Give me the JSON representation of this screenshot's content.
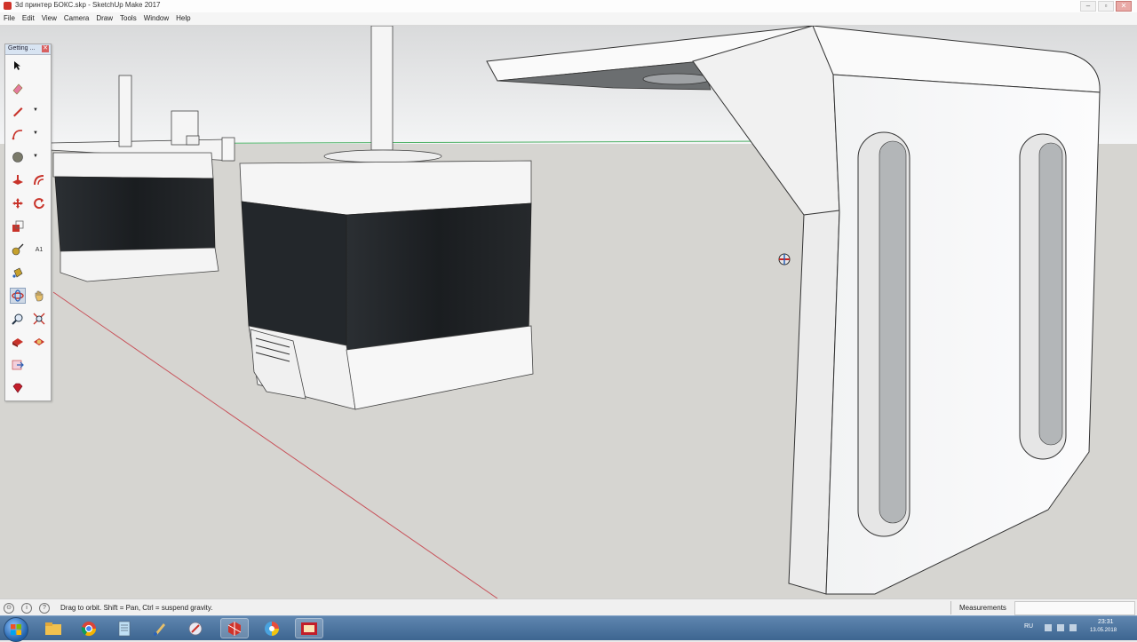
{
  "window": {
    "title": "3d принтер БОКС.skp - SketchUp Make 2017",
    "buttons": [
      "–",
      "▫",
      "✕"
    ]
  },
  "menu": [
    "File",
    "Edit",
    "View",
    "Camera",
    "Draw",
    "Tools",
    "Window",
    "Help"
  ],
  "toolbar": {
    "title": "Getting ...",
    "close": "✕",
    "tools": [
      {
        "name": "select-tool",
        "icon": "arrow-cursor-icon"
      },
      {
        "name": "eraser-tool",
        "icon": "eraser-icon"
      },
      {
        "name": "line-tool",
        "icon": "pencil-icon"
      },
      {
        "name": "arc-tool",
        "icon": "arc-icon"
      },
      {
        "name": "shapes-tool",
        "icon": "circle-shape-icon"
      },
      {
        "name": "push-pull-tool",
        "icon": "push-pull-icon"
      },
      {
        "name": "offset-tool",
        "icon": "offset-icon"
      },
      {
        "name": "move-tool",
        "icon": "move-arrows-icon"
      },
      {
        "name": "rotate-tool",
        "icon": "rotate-icon"
      },
      {
        "name": "scale-tool",
        "icon": "scale-icon"
      },
      {
        "name": "tape-measure-tool",
        "icon": "tape-measure-icon"
      },
      {
        "name": "text-tool",
        "icon": "text-label-icon"
      },
      {
        "name": "paint-bucket-tool",
        "icon": "paint-bucket-icon"
      },
      {
        "name": "orbit-tool",
        "icon": "orbit-icon"
      },
      {
        "name": "pan-tool",
        "icon": "hand-pan-icon"
      },
      {
        "name": "zoom-tool",
        "icon": "magnifier-icon"
      },
      {
        "name": "zoom-extents-tool",
        "icon": "zoom-extents-icon"
      },
      {
        "name": "3d-warehouse-tool",
        "icon": "warehouse-icon"
      },
      {
        "name": "extension-warehouse-tool",
        "icon": "extension-warehouse-icon"
      },
      {
        "name": "send-to-layout-tool",
        "icon": "layout-icon"
      },
      {
        "name": "ruby-console-tool",
        "icon": "ruby-gem-icon"
      }
    ],
    "text_tool_label": "A1"
  },
  "status": {
    "hint": "Drag to orbit. Shift = Pan, Ctrl = suspend gravity.",
    "measurements_label": "Measurements",
    "measurements_value": ""
  },
  "taskbar": {
    "apps": [
      "windows-explorer-icon",
      "chrome-icon",
      "notepad-icon",
      "paint-brush-icon",
      "tool-app-icon",
      "sketchup-icon",
      "color-wheel-icon",
      "presentation-icon"
    ],
    "language": "RU",
    "time": "23:31",
    "date": "13.05.2018"
  },
  "colors": {
    "sky": "#f5f6f7",
    "ground": "#d5d4d0",
    "motor_body": "#1e2124",
    "bracket": "#fafafa",
    "red_axis": "#c8525a",
    "green_axis": "#3fae5a"
  }
}
